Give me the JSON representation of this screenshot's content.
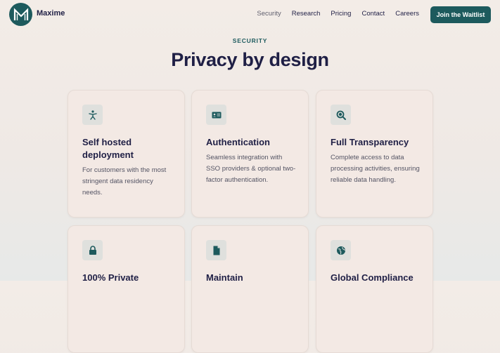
{
  "header": {
    "brand": "Maxime",
    "nav": [
      "Security",
      "Research",
      "Pricing",
      "Contact",
      "Careers"
    ],
    "cta": "Join the Waitlist"
  },
  "section": {
    "eyebrow": "SECURITY",
    "title": "Privacy by design"
  },
  "cards": [
    {
      "icon": "person-icon",
      "title": "Self hosted deployment",
      "desc": "For customers with the most stringent data residency needs."
    },
    {
      "icon": "id-card-icon",
      "title": "Authentication",
      "desc": "Seamless integration with SSO providers & optional two-factor authentication."
    },
    {
      "icon": "magnifier-icon",
      "title": "Full Transparency",
      "desc": "Complete access to data processing activities, ensuring reliable data handling."
    },
    {
      "icon": "lock-icon",
      "title": "100% Private",
      "desc": ""
    },
    {
      "icon": "document-icon",
      "title": "Maintain",
      "desc": ""
    },
    {
      "icon": "globe-icon",
      "title": "Global Compliance",
      "desc": ""
    }
  ],
  "colors": {
    "accent": "#1d5a5d",
    "heading": "#1f1f45",
    "card_bg": "#f3e9e4",
    "icon_bg": "#dfe0dd"
  }
}
